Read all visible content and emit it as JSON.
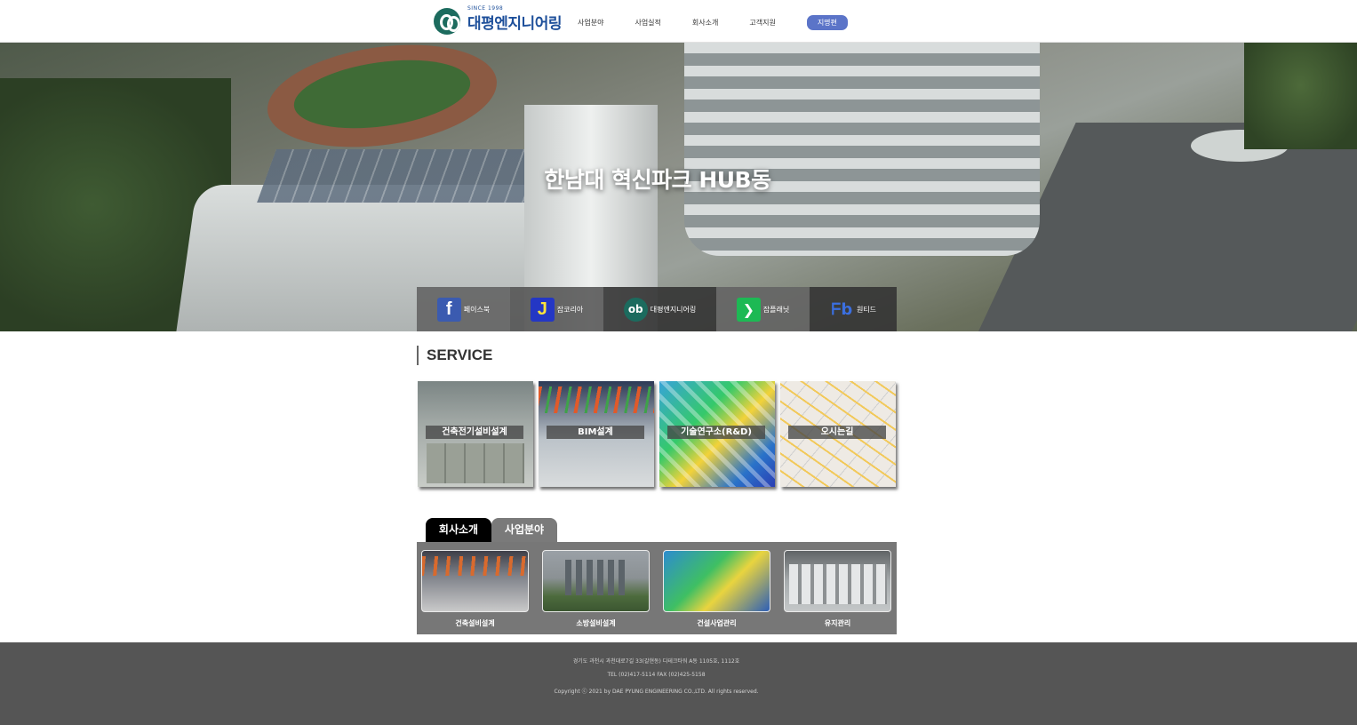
{
  "header": {
    "logo_since": "SINCE 1998",
    "logo_name": "대평엔지니어링",
    "nav": [
      "사업분야",
      "사업실적",
      "회사소개",
      "고객지원",
      "지명편"
    ],
    "nav_active_index": 4
  },
  "hero": {
    "title": "한남대 혁신파크 HUB동"
  },
  "social": [
    {
      "icon": "facebook-icon",
      "label": "페이스북"
    },
    {
      "icon": "jobkorea-icon",
      "label": "잡코리아"
    },
    {
      "icon": "daepyung-logo-icon",
      "label": "대평엔지니어링"
    },
    {
      "icon": "saramin-icon",
      "label": "잡플래닛"
    },
    {
      "icon": "wanted-icon",
      "label": "원티드"
    }
  ],
  "service": {
    "title": "SERVICE",
    "cards": [
      "건축전기설비설계",
      "BIM설계",
      "기술연구소(R&D)",
      "오시는길"
    ]
  },
  "tabs": {
    "items": [
      "회사소개",
      "사업분야"
    ],
    "active_index": 0,
    "thumbnails": [
      "건축설비설계",
      "소방설비설계",
      "건설사업관리",
      "유지관리"
    ]
  },
  "footer": {
    "address": "경기도 과천시 과천대로7길 33(갈현동) 디테크타워 A동 1105호, 1112호",
    "contact": "TEL (02)417-5114 FAX (02)425-5158",
    "copyright": "Copyright ⓒ 2021 by DAE PYUNG ENGINEERING CO.,LTD. All rights reserved."
  },
  "colors": {
    "brand": "#1d4f9a",
    "nav_active": "#5b74c8",
    "footer_bg": "#555555"
  }
}
